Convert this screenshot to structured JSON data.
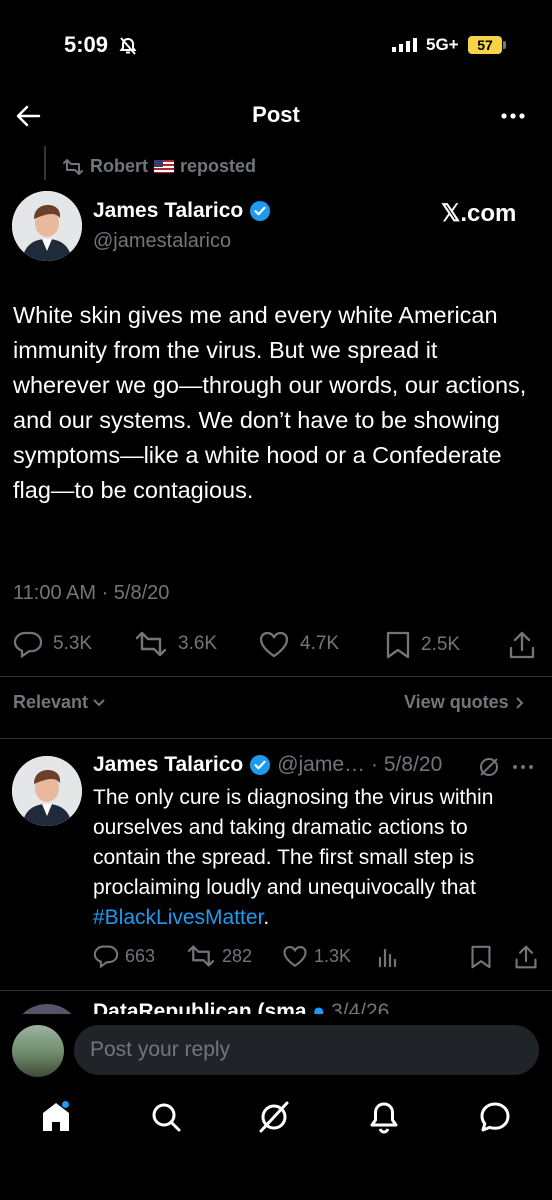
{
  "status_bar": {
    "time": "5:09",
    "network": "5G+",
    "battery": "57"
  },
  "header": {
    "title": "Post"
  },
  "repost": {
    "user": "Robert",
    "label": "reposted"
  },
  "post": {
    "author_name": "James Talarico",
    "author_handle": "@jamestalarico",
    "source": "𝕏.com",
    "text": "White skin gives me and every white American immunity from the virus. But we spread it wherever we go—through our words, our actions, and our systems. We don’t have to be showing symptoms—like a white hood or a Confederate flag—to be contagious.",
    "timestamp": "11:00 AM · 5/8/20",
    "counts": {
      "replies": "5.3K",
      "reposts": "3.6K",
      "likes": "4.7K",
      "bookmarks": "2.5K"
    }
  },
  "sort": {
    "label": "Relevant",
    "view_quotes": "View quotes"
  },
  "reply": {
    "author_name": "James Talarico",
    "author_handle": "@jame…",
    "date": "· 5/8/20",
    "text": "The only cure is diagnosing the virus within ourselves and taking dramatic actions to contain the spread. The first small step is proclaiming loudly and unequivocally that ",
    "hashtag": "#BlackLivesMatter",
    "text_end": ".",
    "counts": {
      "replies": "663",
      "reposts": "282",
      "likes": "1.3K"
    }
  },
  "next_reply_peek": {
    "author_name": "DataRepublican (sma",
    "date": "3/4/26"
  },
  "compose": {
    "placeholder": "Post your reply"
  },
  "colors": {
    "background": "#000000",
    "accent": "#1d9bf0",
    "muted": "#71767b",
    "verified": "#1d9bf0"
  },
  "icons": [
    "back-arrow-icon",
    "more-icon",
    "repost-icon",
    "verified-icon",
    "reply-icon",
    "like-icon",
    "bookmark-icon",
    "share-icon",
    "views-icon",
    "grok-icon",
    "home-icon",
    "search-icon",
    "notifications-icon",
    "messages-icon"
  ]
}
